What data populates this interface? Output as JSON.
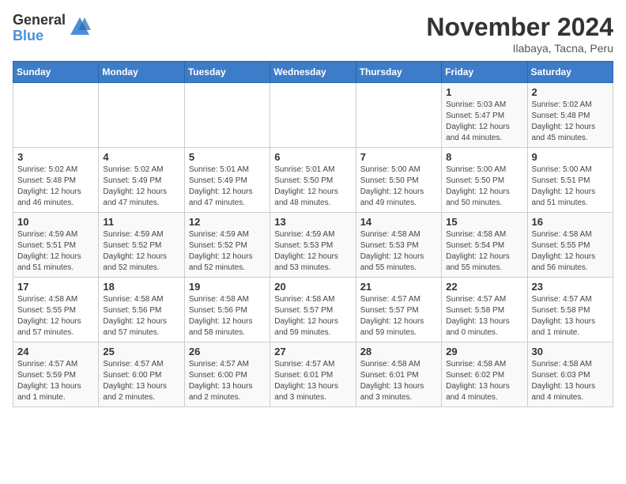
{
  "logo": {
    "general": "General",
    "blue": "Blue"
  },
  "title": "November 2024",
  "location": "Ilabaya, Tacna, Peru",
  "days_of_week": [
    "Sunday",
    "Monday",
    "Tuesday",
    "Wednesday",
    "Thursday",
    "Friday",
    "Saturday"
  ],
  "weeks": [
    [
      {
        "day": "",
        "info": ""
      },
      {
        "day": "",
        "info": ""
      },
      {
        "day": "",
        "info": ""
      },
      {
        "day": "",
        "info": ""
      },
      {
        "day": "",
        "info": ""
      },
      {
        "day": "1",
        "info": "Sunrise: 5:03 AM\nSunset: 5:47 PM\nDaylight: 12 hours\nand 44 minutes."
      },
      {
        "day": "2",
        "info": "Sunrise: 5:02 AM\nSunset: 5:48 PM\nDaylight: 12 hours\nand 45 minutes."
      }
    ],
    [
      {
        "day": "3",
        "info": "Sunrise: 5:02 AM\nSunset: 5:48 PM\nDaylight: 12 hours\nand 46 minutes."
      },
      {
        "day": "4",
        "info": "Sunrise: 5:02 AM\nSunset: 5:49 PM\nDaylight: 12 hours\nand 47 minutes."
      },
      {
        "day": "5",
        "info": "Sunrise: 5:01 AM\nSunset: 5:49 PM\nDaylight: 12 hours\nand 47 minutes."
      },
      {
        "day": "6",
        "info": "Sunrise: 5:01 AM\nSunset: 5:50 PM\nDaylight: 12 hours\nand 48 minutes."
      },
      {
        "day": "7",
        "info": "Sunrise: 5:00 AM\nSunset: 5:50 PM\nDaylight: 12 hours\nand 49 minutes."
      },
      {
        "day": "8",
        "info": "Sunrise: 5:00 AM\nSunset: 5:50 PM\nDaylight: 12 hours\nand 50 minutes."
      },
      {
        "day": "9",
        "info": "Sunrise: 5:00 AM\nSunset: 5:51 PM\nDaylight: 12 hours\nand 51 minutes."
      }
    ],
    [
      {
        "day": "10",
        "info": "Sunrise: 4:59 AM\nSunset: 5:51 PM\nDaylight: 12 hours\nand 51 minutes."
      },
      {
        "day": "11",
        "info": "Sunrise: 4:59 AM\nSunset: 5:52 PM\nDaylight: 12 hours\nand 52 minutes."
      },
      {
        "day": "12",
        "info": "Sunrise: 4:59 AM\nSunset: 5:52 PM\nDaylight: 12 hours\nand 52 minutes."
      },
      {
        "day": "13",
        "info": "Sunrise: 4:59 AM\nSunset: 5:53 PM\nDaylight: 12 hours\nand 53 minutes."
      },
      {
        "day": "14",
        "info": "Sunrise: 4:58 AM\nSunset: 5:53 PM\nDaylight: 12 hours\nand 55 minutes."
      },
      {
        "day": "15",
        "info": "Sunrise: 4:58 AM\nSunset: 5:54 PM\nDaylight: 12 hours\nand 55 minutes."
      },
      {
        "day": "16",
        "info": "Sunrise: 4:58 AM\nSunset: 5:55 PM\nDaylight: 12 hours\nand 56 minutes."
      }
    ],
    [
      {
        "day": "17",
        "info": "Sunrise: 4:58 AM\nSunset: 5:55 PM\nDaylight: 12 hours\nand 57 minutes."
      },
      {
        "day": "18",
        "info": "Sunrise: 4:58 AM\nSunset: 5:56 PM\nDaylight: 12 hours\nand 57 minutes."
      },
      {
        "day": "19",
        "info": "Sunrise: 4:58 AM\nSunset: 5:56 PM\nDaylight: 12 hours\nand 58 minutes."
      },
      {
        "day": "20",
        "info": "Sunrise: 4:58 AM\nSunset: 5:57 PM\nDaylight: 12 hours\nand 59 minutes."
      },
      {
        "day": "21",
        "info": "Sunrise: 4:57 AM\nSunset: 5:57 PM\nDaylight: 12 hours\nand 59 minutes."
      },
      {
        "day": "22",
        "info": "Sunrise: 4:57 AM\nSunset: 5:58 PM\nDaylight: 13 hours\nand 0 minutes."
      },
      {
        "day": "23",
        "info": "Sunrise: 4:57 AM\nSunset: 5:58 PM\nDaylight: 13 hours\nand 1 minute."
      }
    ],
    [
      {
        "day": "24",
        "info": "Sunrise: 4:57 AM\nSunset: 5:59 PM\nDaylight: 13 hours\nand 1 minute."
      },
      {
        "day": "25",
        "info": "Sunrise: 4:57 AM\nSunset: 6:00 PM\nDaylight: 13 hours\nand 2 minutes."
      },
      {
        "day": "26",
        "info": "Sunrise: 4:57 AM\nSunset: 6:00 PM\nDaylight: 13 hours\nand 2 minutes."
      },
      {
        "day": "27",
        "info": "Sunrise: 4:57 AM\nSunset: 6:01 PM\nDaylight: 13 hours\nand 3 minutes."
      },
      {
        "day": "28",
        "info": "Sunrise: 4:58 AM\nSunset: 6:01 PM\nDaylight: 13 hours\nand 3 minutes."
      },
      {
        "day": "29",
        "info": "Sunrise: 4:58 AM\nSunset: 6:02 PM\nDaylight: 13 hours\nand 4 minutes."
      },
      {
        "day": "30",
        "info": "Sunrise: 4:58 AM\nSunset: 6:03 PM\nDaylight: 13 hours\nand 4 minutes."
      }
    ]
  ]
}
